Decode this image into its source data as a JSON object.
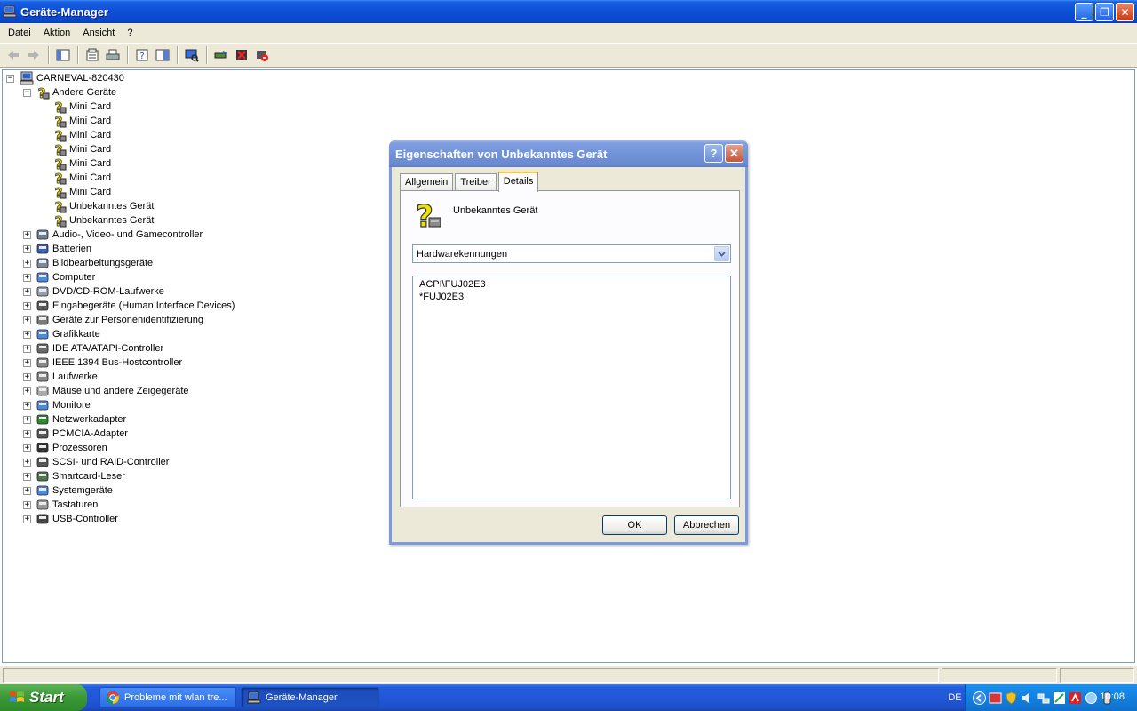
{
  "window": {
    "title": "Geräte-Manager",
    "min_label": "_",
    "max_label": "❐",
    "close_label": "✕"
  },
  "menu": [
    "Datei",
    "Aktion",
    "Ansicht",
    "?"
  ],
  "tree": {
    "root": "CARNEVAL-820430",
    "other_devices": {
      "label": "Andere Geräte",
      "children": [
        "Mini Card",
        "Mini Card",
        "Mini Card",
        "Mini Card",
        "Mini Card",
        "Mini Card",
        "Mini Card",
        "Unbekanntes Gerät",
        "Unbekanntes Gerät"
      ]
    },
    "categories": [
      {
        "label": "Audio-, Video- und Gamecontroller",
        "icon": "audio-icon"
      },
      {
        "label": "Batterien",
        "icon": "battery-icon"
      },
      {
        "label": "Bildbearbeitungsgeräte",
        "icon": "camera-icon"
      },
      {
        "label": "Computer",
        "icon": "computer-icon"
      },
      {
        "label": "DVD/CD-ROM-Laufwerke",
        "icon": "cdrom-icon"
      },
      {
        "label": "Eingabegeräte (Human Interface Devices)",
        "icon": "hid-icon"
      },
      {
        "label": "Geräte zur Personenidentifizierung",
        "icon": "biometric-icon"
      },
      {
        "label": "Grafikkarte",
        "icon": "display-adapter-icon"
      },
      {
        "label": "IDE ATA/ATAPI-Controller",
        "icon": "ide-icon"
      },
      {
        "label": "IEEE 1394 Bus-Hostcontroller",
        "icon": "firewire-icon"
      },
      {
        "label": "Laufwerke",
        "icon": "disk-icon"
      },
      {
        "label": "Mäuse und andere Zeigegeräte",
        "icon": "mouse-icon"
      },
      {
        "label": "Monitore",
        "icon": "monitor-icon"
      },
      {
        "label": "Netzwerkadapter",
        "icon": "network-icon"
      },
      {
        "label": "PCMCIA-Adapter",
        "icon": "pcmcia-icon"
      },
      {
        "label": "Prozessoren",
        "icon": "cpu-icon"
      },
      {
        "label": "SCSI- und RAID-Controller",
        "icon": "scsi-icon"
      },
      {
        "label": "Smartcard-Leser",
        "icon": "smartcard-icon"
      },
      {
        "label": "Systemgeräte",
        "icon": "system-icon"
      },
      {
        "label": "Tastaturen",
        "icon": "keyboard-icon"
      },
      {
        "label": "USB-Controller",
        "icon": "usb-icon"
      }
    ]
  },
  "dialog": {
    "title": "Eigenschaften von Unbekanntes Gerät",
    "help_label": "?",
    "close_label": "✕",
    "tabs": [
      "Allgemein",
      "Treiber",
      "Details"
    ],
    "active_tab": "Details",
    "device_name": "Unbekanntes Gerät",
    "property_select": "Hardwarekennungen",
    "values": [
      "ACPI\\FUJ02E3",
      "*FUJ02E3"
    ],
    "ok_label": "OK",
    "cancel_label": "Abbrechen"
  },
  "taskbar": {
    "start_label": "Start",
    "tasks": [
      {
        "label": "Probleme mit wlan tre...",
        "icon": "chrome-icon"
      },
      {
        "label": "Geräte-Manager",
        "icon": "device-manager-icon"
      }
    ],
    "language": "DE",
    "clock": "10:08"
  },
  "colors": {
    "titlebar": "#0b4fd8",
    "taskbar": "#245edb",
    "start": "#3d9a38",
    "tab_highlight": "#ffc83c"
  }
}
